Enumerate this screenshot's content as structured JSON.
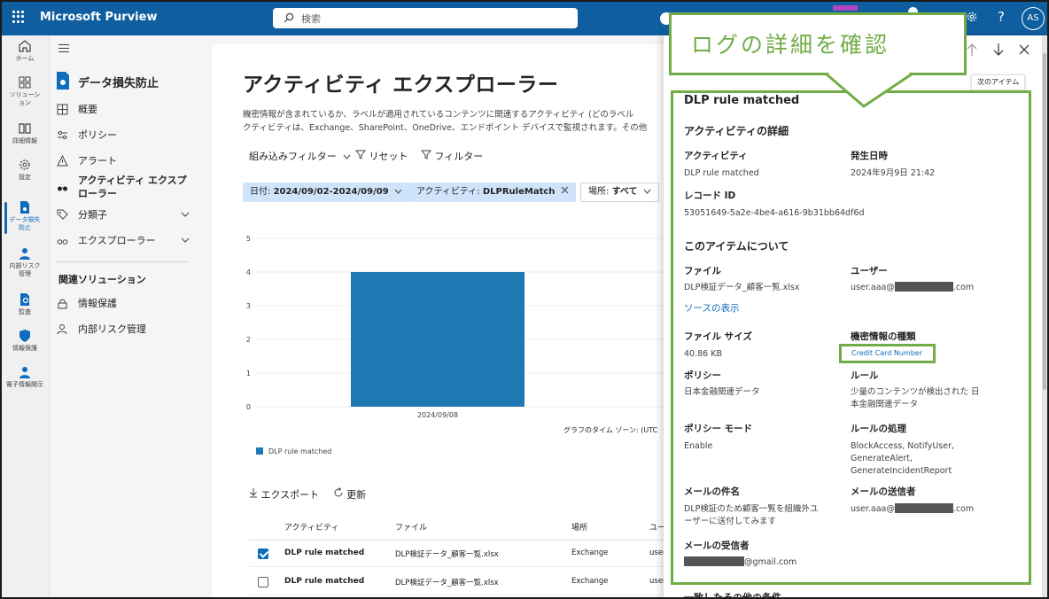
{
  "topbar": {
    "brand": "Microsoft Purview",
    "search_placeholder": "検索",
    "help": "?",
    "avatar": "AS"
  },
  "rail": {
    "items": [
      {
        "label": "ホーム",
        "icon": "home-icon"
      },
      {
        "label": "ソリューション",
        "icon": "solutions-icon"
      },
      {
        "label": "詳細情報",
        "icon": "learn-icon"
      },
      {
        "label": "設定",
        "icon": "settings-icon"
      },
      {
        "label": "データ損失防止",
        "icon": "dlp-icon"
      },
      {
        "label": "内部リスク管理",
        "icon": "insider-risk-icon"
      },
      {
        "label": "監査",
        "icon": "audit-icon"
      },
      {
        "label": "情報保護",
        "icon": "info-protection-icon"
      },
      {
        "label": "電子情報開示",
        "icon": "ediscovery-icon"
      }
    ]
  },
  "nav": {
    "title": "データ損失防止",
    "items": [
      {
        "label": "概要"
      },
      {
        "label": "ポリシー"
      },
      {
        "label": "アラート"
      },
      {
        "label": "アクティビティ エクスプ"
      },
      {
        "label": "ローラー"
      },
      {
        "label": "分類子"
      },
      {
        "label": "エクスプローラー"
      }
    ],
    "related_header": "関連ソリューション",
    "related": [
      {
        "label": "情報保護"
      },
      {
        "label": "内部リスク管理"
      }
    ]
  },
  "main": {
    "title": "アクティビティ エクスプローラー",
    "desc_line1": "機密情報が含まれているか、ラベルが適用されているコンテンツに関連するアクティビティ (どのラベル",
    "desc_line2": "クティビティは、Exchange、SharePoint、OneDrive、エンドポイント デバイスで監視されます。その他",
    "toolbar": {
      "builtin": "組み込みフィルター",
      "reset": "リセット",
      "filter": "フィルター"
    },
    "chips": {
      "date_key": "日付:",
      "date_val": "2024/09/02-2024/09/09",
      "activity_key": "アクティビティ:",
      "activity_val": "DLPRuleMatch",
      "location_key": "場所:",
      "location_val": "すべて"
    },
    "timezone": "グラフのタイム ゾーン: (UTC",
    "legend": "DLP rule matched",
    "export": "エクスポート",
    "refresh": "更新",
    "table": {
      "headers": [
        "アクティビティ",
        "ファイル",
        "場所",
        "ユー"
      ],
      "rows": [
        {
          "activity": "DLP rule matched",
          "file": "DLP検証データ_顧客一覧.xlsx",
          "location": "Exchange",
          "user": "user",
          "checked": true
        },
        {
          "activity": "DLP rule matched",
          "file": "DLP検証データ_顧客一覧.xlsx",
          "location": "Exchange",
          "user": "user",
          "checked": false
        }
      ]
    }
  },
  "chart_data": {
    "type": "bar",
    "categories": [
      "2024/09/08"
    ],
    "series": [
      {
        "name": "DLP rule matched",
        "values": [
          4
        ]
      }
    ],
    "ylim": [
      0,
      5
    ],
    "yticks": [
      "5",
      "4",
      "3",
      "2",
      "1",
      "0"
    ],
    "grid": true,
    "legend": "bottom-left",
    "color": "#1f78b4"
  },
  "panel": {
    "tooltip": "次のアイテム",
    "callout": "ログの詳細を確認",
    "heading": "DLP rule matched",
    "section1": "アクティビティの詳細",
    "activity_key": "アクティビティ",
    "activity_val": "DLP rule matched",
    "date_key": "発生日時",
    "date_val": "2024年9月9日 21:42",
    "record_key": "レコード ID",
    "record_val": "53051649-5a2e-4be4-a616-9b31bb64df6d",
    "section2": "このアイテムについて",
    "file_key": "ファイル",
    "file_val": "DLP検証データ_顧客一覧.xlsx",
    "user_key": "ユーザー",
    "user_prefix": "user.aaa@",
    "user_suffix": ".com",
    "source_link": "ソースの表示",
    "size_key": "ファイル サイズ",
    "size_val": "40.86 KB",
    "sit_key": "機密情報の種類",
    "sit_val": "Credit Card Number",
    "policy_key": "ポリシー",
    "policy_val": "日本金融関連データ",
    "rule_key": "ルール",
    "rule_val1": "少量のコンテンツが検出された 日",
    "rule_val2": "本金融関連データ",
    "mode_key": "ポリシー モード",
    "mode_val": "Enable",
    "action_key": "ルールの処理",
    "action_val1": "BlockAccess, NotifyUser,",
    "action_val2": "GenerateAlert,",
    "action_val3": "GenerateIncidentReport",
    "subject_key": "メールの件名",
    "subject_val1": "DLP検証のため顧客一覧を組織外ユ",
    "subject_val2": "ーザーに送付してみます",
    "sender_key": "メールの送信者",
    "sender_prefix": "user.aaa@",
    "sender_suffix": ".com",
    "recipient_key": "メールの受信者",
    "recipient_suffix": "@gmail.com",
    "bottom_cut": "一致したその他の条件"
  }
}
